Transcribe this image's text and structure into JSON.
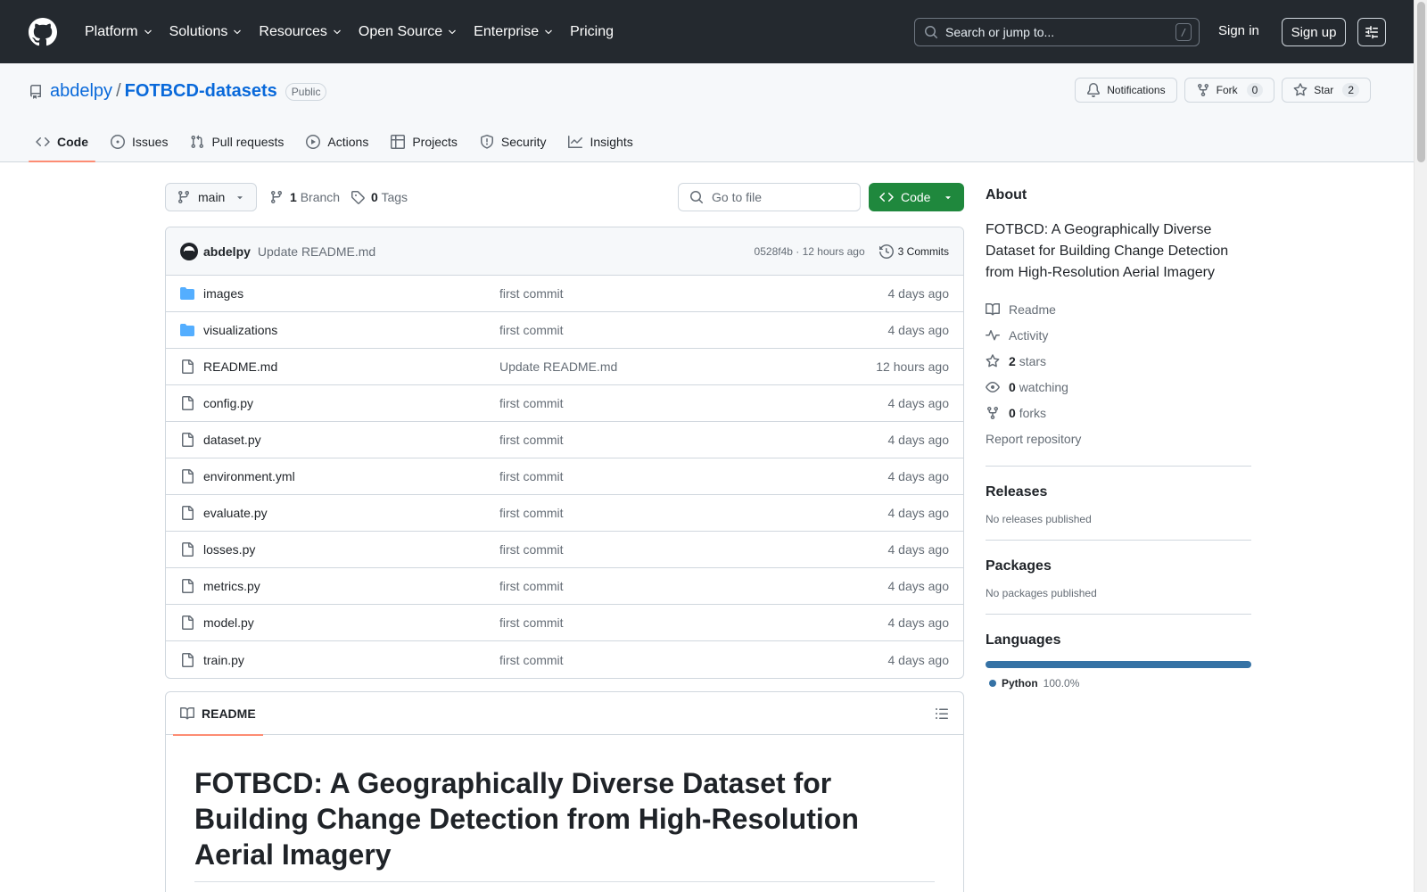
{
  "header": {
    "nav": [
      {
        "label": "Platform",
        "has_menu": true
      },
      {
        "label": "Solutions",
        "has_menu": true
      },
      {
        "label": "Resources",
        "has_menu": true
      },
      {
        "label": "Open Source",
        "has_menu": true
      },
      {
        "label": "Enterprise",
        "has_menu": true
      },
      {
        "label": "Pricing",
        "has_menu": false
      }
    ],
    "search_placeholder": "Search or jump to...",
    "search_key": "/",
    "sign_in": "Sign in",
    "sign_up": "Sign up"
  },
  "repo": {
    "owner": "abdelpy",
    "separator": "/",
    "name": "FOTBCD-datasets",
    "visibility": "Public",
    "actions": {
      "notifications": "Notifications",
      "fork_label": "Fork",
      "fork_count": "0",
      "star_label": "Star",
      "star_count": "2"
    },
    "tabs": [
      {
        "label": "Code",
        "icon": "code-icon",
        "active": true
      },
      {
        "label": "Issues",
        "icon": "issue-icon",
        "active": false
      },
      {
        "label": "Pull requests",
        "icon": "pull-request-icon",
        "active": false
      },
      {
        "label": "Actions",
        "icon": "play-icon",
        "active": false
      },
      {
        "label": "Projects",
        "icon": "table-icon",
        "active": false
      },
      {
        "label": "Security",
        "icon": "shield-icon",
        "active": false
      },
      {
        "label": "Insights",
        "icon": "graph-icon",
        "active": false
      }
    ]
  },
  "toolbar": {
    "branch": "main",
    "branch_count": "1",
    "branch_label": "Branch",
    "tag_count": "0",
    "tag_label": "Tags",
    "goto_placeholder": "Go to file",
    "code_button": "Code"
  },
  "latest_commit": {
    "author": "abdelpy",
    "message": "Update README.md",
    "meta": "0528f4b · 12 hours ago",
    "commits": "3 Commits"
  },
  "files": [
    {
      "name": "images",
      "type": "dir",
      "commit": "first commit",
      "age": "4 days ago"
    },
    {
      "name": "visualizations",
      "type": "dir",
      "commit": "first commit",
      "age": "4 days ago"
    },
    {
      "name": "README.md",
      "type": "file",
      "commit": "Update README.md",
      "age": "12 hours ago"
    },
    {
      "name": "config.py",
      "type": "file",
      "commit": "first commit",
      "age": "4 days ago"
    },
    {
      "name": "dataset.py",
      "type": "file",
      "commit": "first commit",
      "age": "4 days ago"
    },
    {
      "name": "environment.yml",
      "type": "file",
      "commit": "first commit",
      "age": "4 days ago"
    },
    {
      "name": "evaluate.py",
      "type": "file",
      "commit": "first commit",
      "age": "4 days ago"
    },
    {
      "name": "losses.py",
      "type": "file",
      "commit": "first commit",
      "age": "4 days ago"
    },
    {
      "name": "metrics.py",
      "type": "file",
      "commit": "first commit",
      "age": "4 days ago"
    },
    {
      "name": "model.py",
      "type": "file",
      "commit": "first commit",
      "age": "4 days ago"
    },
    {
      "name": "train.py",
      "type": "file",
      "commit": "first commit",
      "age": "4 days ago"
    }
  ],
  "readme": {
    "tab_label": "README",
    "heading": "FOTBCD: A Geographically Diverse Dataset for Building Change Detection from High-Resolution Aerial Imagery"
  },
  "sidebar": {
    "about_title": "About",
    "description": "FOTBCD: A Geographically Diverse Dataset for Building Change Detection from High-Resolution Aerial Imagery",
    "readme": "Readme",
    "activity": "Activity",
    "stars_count": "2",
    "stars_label": "stars",
    "watching_count": "0",
    "watching_label": "watching",
    "forks_count": "0",
    "forks_label": "forks",
    "report": "Report repository",
    "releases_title": "Releases",
    "releases_empty": "No releases published",
    "packages_title": "Packages",
    "packages_empty": "No packages published",
    "languages_title": "Languages",
    "languages": [
      {
        "name": "Python",
        "percent": "100.0%",
        "color": "#3572A5",
        "share": 1.0
      }
    ]
  },
  "colors": {
    "accent": "#0969da",
    "header_bg": "#24292f",
    "code_button": "#1f883d",
    "tab_underline": "#fd8c73",
    "folder": "#54aeff"
  }
}
